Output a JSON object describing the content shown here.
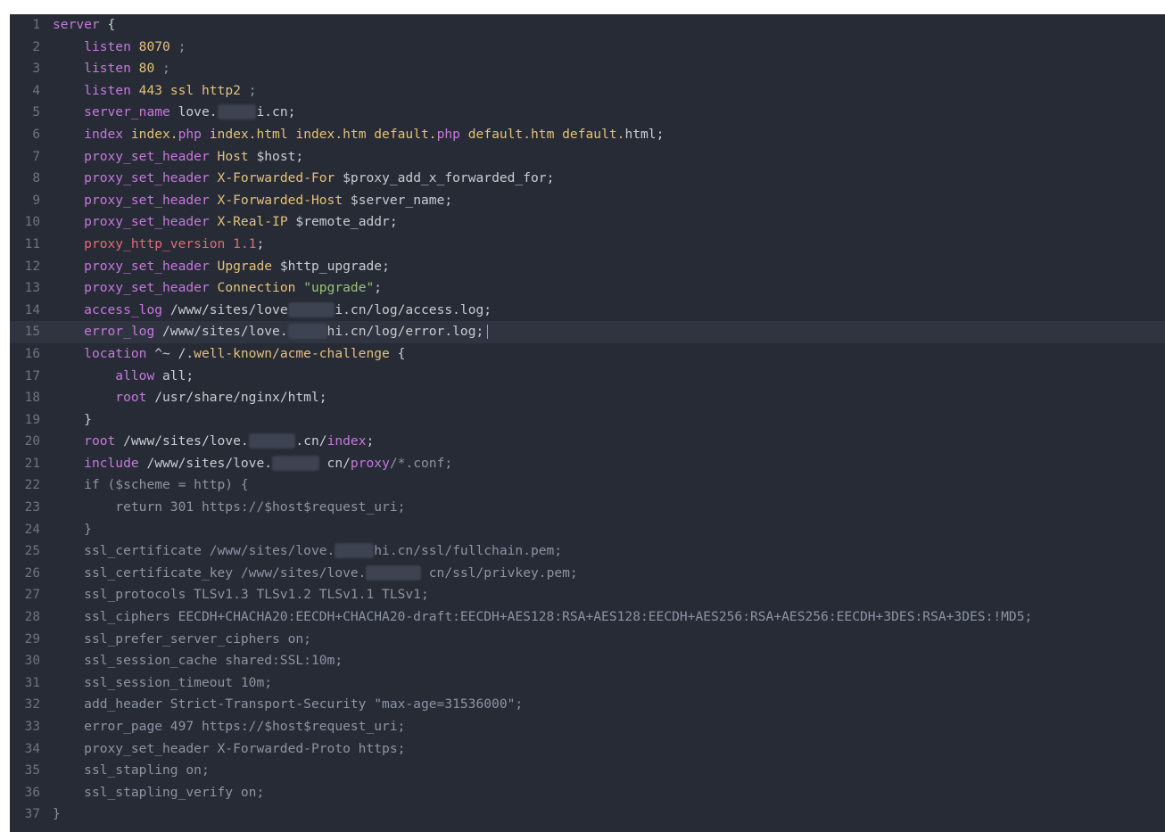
{
  "colors": {
    "background": "#262b35",
    "keyword": "#c678dd",
    "directive_red": "#e06c75",
    "value_yellow": "#e5c07b",
    "string_green": "#98c379",
    "plain": "#c9ccd3",
    "dim": "#8d94a3",
    "line_number": "#6d7585",
    "caret": "#6aa8ff"
  },
  "editor": {
    "active_line": 15,
    "lines": [
      {
        "n": "1",
        "tokens": [
          {
            "t": "server",
            "c": "kw"
          },
          {
            "t": " {",
            "c": "plain"
          }
        ]
      },
      {
        "n": "2",
        "tokens": [
          {
            "t": "    "
          },
          {
            "t": "listen",
            "c": "kw"
          },
          {
            "t": " "
          },
          {
            "t": "8070",
            "c": "num"
          },
          {
            "t": " ;",
            "c": "dim"
          }
        ]
      },
      {
        "n": "3",
        "tokens": [
          {
            "t": "    "
          },
          {
            "t": "listen",
            "c": "kw"
          },
          {
            "t": " "
          },
          {
            "t": "80",
            "c": "num"
          },
          {
            "t": " ;",
            "c": "dim"
          }
        ]
      },
      {
        "n": "4",
        "tokens": [
          {
            "t": "    "
          },
          {
            "t": "listen",
            "c": "kw"
          },
          {
            "t": " "
          },
          {
            "t": "443 ssl http2",
            "c": "num"
          },
          {
            "t": " ;",
            "c": "dim"
          }
        ]
      },
      {
        "n": "5",
        "tokens": [
          {
            "t": "    "
          },
          {
            "t": "server_name",
            "c": "kw"
          },
          {
            "t": " love."
          },
          {
            "t": "     ",
            "c": "blur"
          },
          {
            "t": "i.cn;"
          }
        ]
      },
      {
        "n": "6",
        "tokens": [
          {
            "t": "    "
          },
          {
            "t": "index",
            "c": "kw"
          },
          {
            "t": " index.",
            "c": "yel"
          },
          {
            "t": "php",
            "c": "kw"
          },
          {
            "t": " index.html index.htm default.",
            "c": "yel"
          },
          {
            "t": "php",
            "c": "kw"
          },
          {
            "t": " default.htm default.",
            "c": "yel"
          },
          {
            "t": "html;"
          }
        ]
      },
      {
        "n": "7",
        "tokens": [
          {
            "t": "    "
          },
          {
            "t": "proxy_set_header",
            "c": "kw"
          },
          {
            "t": " "
          },
          {
            "t": "Host",
            "c": "yel"
          },
          {
            "t": " $host;"
          }
        ]
      },
      {
        "n": "8",
        "tokens": [
          {
            "t": "    "
          },
          {
            "t": "proxy_set_header",
            "c": "kw"
          },
          {
            "t": " "
          },
          {
            "t": "X-Forwarded-For",
            "c": "yel"
          },
          {
            "t": " $proxy_add_x_forwarded_for;"
          }
        ]
      },
      {
        "n": "9",
        "tokens": [
          {
            "t": "    "
          },
          {
            "t": "proxy_set_header",
            "c": "kw"
          },
          {
            "t": " "
          },
          {
            "t": "X-Forwarded-Host",
            "c": "yel"
          },
          {
            "t": " $server_name;"
          }
        ]
      },
      {
        "n": "10",
        "tokens": [
          {
            "t": "    "
          },
          {
            "t": "proxy_set_header",
            "c": "kw"
          },
          {
            "t": " "
          },
          {
            "t": "X-Real-IP",
            "c": "yel"
          },
          {
            "t": " $remote_addr;"
          }
        ]
      },
      {
        "n": "11",
        "tokens": [
          {
            "t": "    "
          },
          {
            "t": "proxy_http_version",
            "c": "red"
          },
          {
            "t": " "
          },
          {
            "t": "1.1",
            "c": "red"
          },
          {
            "t": ";"
          }
        ]
      },
      {
        "n": "12",
        "tokens": [
          {
            "t": "    "
          },
          {
            "t": "proxy_set_header",
            "c": "kw"
          },
          {
            "t": " "
          },
          {
            "t": "Upgrade",
            "c": "yel"
          },
          {
            "t": " $http_upgrade;"
          }
        ]
      },
      {
        "n": "13",
        "tokens": [
          {
            "t": "    "
          },
          {
            "t": "proxy_set_header",
            "c": "kw"
          },
          {
            "t": " "
          },
          {
            "t": "Connection",
            "c": "yel"
          },
          {
            "t": " "
          },
          {
            "t": "\"upgrade\"",
            "c": "str"
          },
          {
            "t": ";"
          }
        ]
      },
      {
        "n": "14",
        "tokens": [
          {
            "t": "    "
          },
          {
            "t": "access_log",
            "c": "kw"
          },
          {
            "t": " /www/sites/love"
          },
          {
            "t": "      ",
            "c": "blur"
          },
          {
            "t": "i.cn/log/access.log;"
          }
        ]
      },
      {
        "n": "15",
        "tokens": [
          {
            "t": "    "
          },
          {
            "t": "error_log",
            "c": "kw"
          },
          {
            "t": " /www/sites/love."
          },
          {
            "t": "     ",
            "c": "blur"
          },
          {
            "t": "hi.cn/log/error.log;"
          }
        ],
        "caret": true
      },
      {
        "n": "16",
        "tokens": [
          {
            "t": "    "
          },
          {
            "t": "location",
            "c": "kw"
          },
          {
            "t": " ^~ /."
          },
          {
            "t": "well-known/acme-challenge",
            "c": "yel"
          },
          {
            "t": " {"
          }
        ]
      },
      {
        "n": "17",
        "tokens": [
          {
            "t": "        "
          },
          {
            "t": "allow",
            "c": "kw"
          },
          {
            "t": " all;"
          }
        ]
      },
      {
        "n": "18",
        "tokens": [
          {
            "t": "        "
          },
          {
            "t": "root",
            "c": "kw"
          },
          {
            "t": " /usr/share/nginx/html;"
          }
        ]
      },
      {
        "n": "19",
        "tokens": [
          {
            "t": "    }"
          }
        ]
      },
      {
        "n": "20",
        "tokens": [
          {
            "t": "    "
          },
          {
            "t": "root",
            "c": "kw"
          },
          {
            "t": " /www/sites/love."
          },
          {
            "t": "      ",
            "c": "blur"
          },
          {
            "t": ".cn/"
          },
          {
            "t": "index",
            "c": "kw"
          },
          {
            "t": ";"
          }
        ]
      },
      {
        "n": "21",
        "tokens": [
          {
            "t": "    "
          },
          {
            "t": "include",
            "c": "kw"
          },
          {
            "t": " /www/sites/love."
          },
          {
            "t": "      ",
            "c": "blur"
          },
          {
            "t": " cn/"
          },
          {
            "t": "proxy",
            "c": "kw"
          },
          {
            "t": "/*.conf;",
            "c": "dim"
          }
        ]
      },
      {
        "n": "22",
        "tokens": [
          {
            "t": "    "
          },
          {
            "t": "if ($scheme = http) {",
            "c": "dim"
          }
        ]
      },
      {
        "n": "23",
        "tokens": [
          {
            "t": "        "
          },
          {
            "t": "return 301 https://$host$request_uri;",
            "c": "dim"
          }
        ]
      },
      {
        "n": "24",
        "tokens": [
          {
            "t": "    }",
            "c": "dim"
          }
        ]
      },
      {
        "n": "25",
        "tokens": [
          {
            "t": "    "
          },
          {
            "t": "ssl_certificate /www/sites/love.",
            "c": "dim"
          },
          {
            "t": "     ",
            "c": "blur"
          },
          {
            "t": "hi.cn/ssl/fullchain.pem;",
            "c": "dim"
          }
        ]
      },
      {
        "n": "26",
        "tokens": [
          {
            "t": "    "
          },
          {
            "t": "ssl_certificate_key /www/sites/love.",
            "c": "dim"
          },
          {
            "t": "       ",
            "c": "blur"
          },
          {
            "t": " cn/ssl/privkey.pem;",
            "c": "dim"
          }
        ]
      },
      {
        "n": "27",
        "tokens": [
          {
            "t": "    "
          },
          {
            "t": "ssl_protocols TLSv1.3 TLSv1.2 TLSv1.1 TLSv1;",
            "c": "dim"
          }
        ]
      },
      {
        "n": "28",
        "tokens": [
          {
            "t": "    "
          },
          {
            "t": "ssl_ciphers EECDH+CHACHA20:EECDH+CHACHA20-draft:EECDH+AES128:RSA+AES128:EECDH+AES256:RSA+AES256:EECDH+3DES:RSA+3DES:!MD5;",
            "c": "dim"
          }
        ]
      },
      {
        "n": "29",
        "tokens": [
          {
            "t": "    "
          },
          {
            "t": "ssl_prefer_server_ciphers on;",
            "c": "dim"
          }
        ]
      },
      {
        "n": "30",
        "tokens": [
          {
            "t": "    "
          },
          {
            "t": "ssl_session_cache shared:SSL:10m;",
            "c": "dim"
          }
        ]
      },
      {
        "n": "31",
        "tokens": [
          {
            "t": "    "
          },
          {
            "t": "ssl_session_timeout 10m;",
            "c": "dim"
          }
        ]
      },
      {
        "n": "32",
        "tokens": [
          {
            "t": "    "
          },
          {
            "t": "add_header Strict-Transport-Security \"max-age=31536000\";",
            "c": "dim"
          }
        ]
      },
      {
        "n": "33",
        "tokens": [
          {
            "t": "    "
          },
          {
            "t": "error_page 497 https://$host$request_uri;",
            "c": "dim"
          }
        ]
      },
      {
        "n": "34",
        "tokens": [
          {
            "t": "    "
          },
          {
            "t": "proxy_set_header X-Forwarded-Proto https;",
            "c": "dim"
          }
        ]
      },
      {
        "n": "35",
        "tokens": [
          {
            "t": "    "
          },
          {
            "t": "ssl_stapling on;",
            "c": "dim"
          }
        ]
      },
      {
        "n": "36",
        "tokens": [
          {
            "t": "    "
          },
          {
            "t": "ssl_stapling_verify on;",
            "c": "dim"
          }
        ]
      },
      {
        "n": "37",
        "tokens": [
          {
            "t": "}",
            "c": "dim"
          }
        ]
      }
    ]
  }
}
